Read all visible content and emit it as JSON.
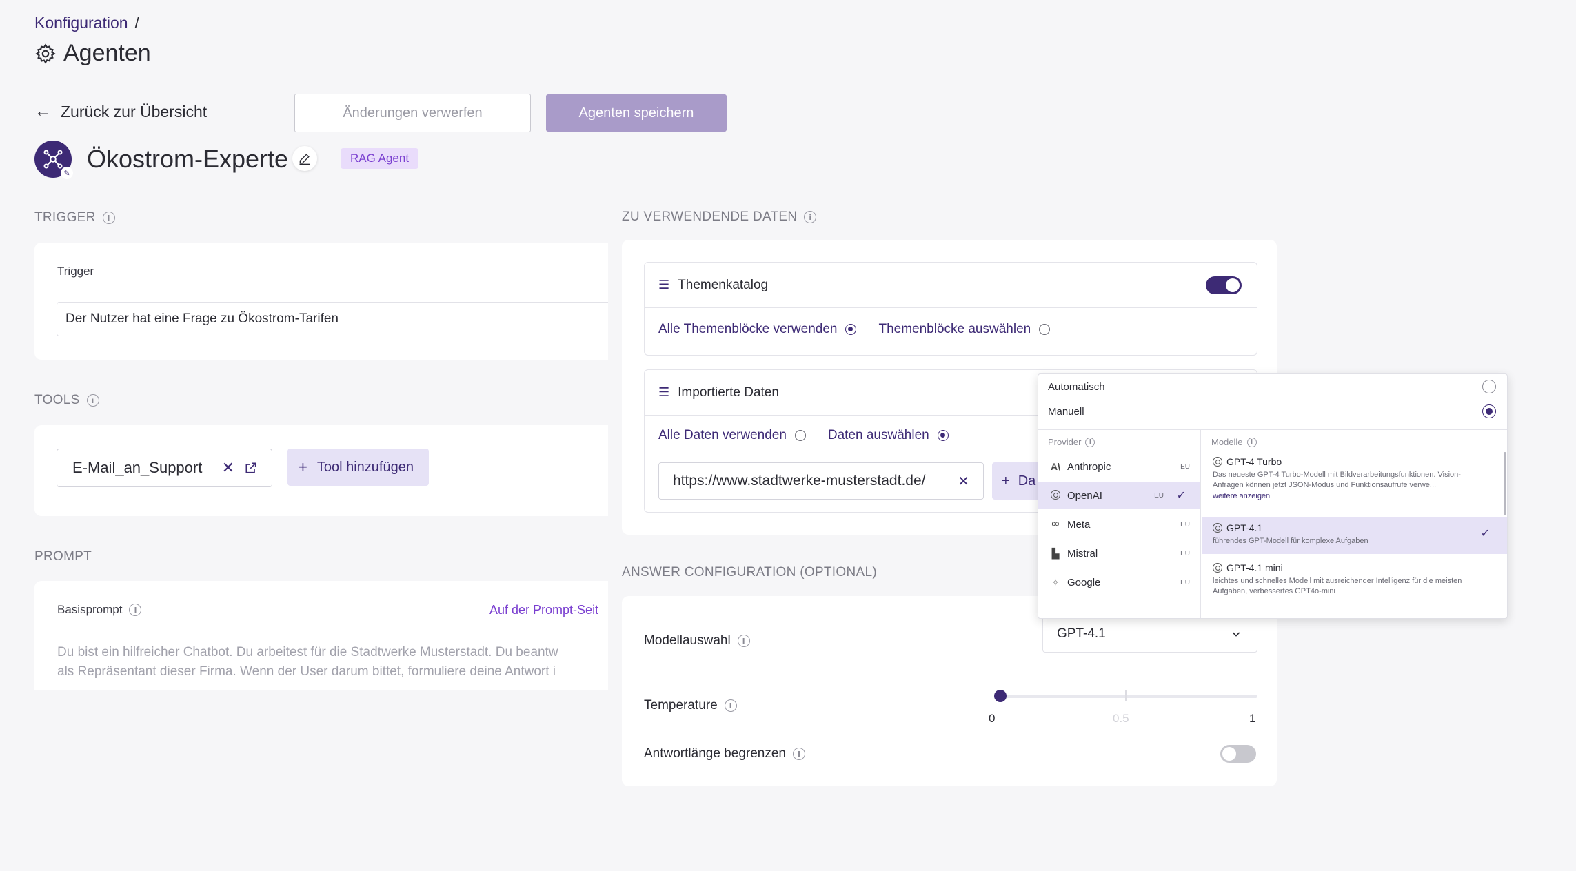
{
  "breadcrumb": {
    "item": "Konfiguration",
    "separator": "/"
  },
  "page": {
    "title": "Agenten"
  },
  "toolbar": {
    "back_label": "Zurück zur Übersicht",
    "discard_label": "Änderungen verwerfen",
    "save_label": "Agenten speichern"
  },
  "agent": {
    "name": "Ökostrom-Experte",
    "badge": "RAG Agent"
  },
  "trigger": {
    "section": "TRIGGER",
    "label": "Trigger",
    "value": "Der Nutzer hat eine Frage zu Ökostrom-Tarifen"
  },
  "tools": {
    "section": "TOOLS",
    "chip": "E-Mail_an_Support",
    "add_label": "Tool hinzufügen"
  },
  "prompt": {
    "section": "PROMPT",
    "label": "Basisprompt",
    "link": "Auf der Prompt-Seit",
    "text_line1": "Du bist ein hilfreicher Chatbot. Du arbeitest für die Stadtwerke Musterstadt. Du beantw",
    "text_line2": "als Repräsentant dieser Firma. Wenn der User darum bittet, formuliere deine Antwort i"
  },
  "data_section": {
    "section": "ZU VERWENDENDE DATEN",
    "catalog": {
      "title": "Themenkatalog",
      "enabled": true,
      "option_all": "Alle Themenblöcke verwenden",
      "option_select": "Themenblöcke auswählen"
    },
    "imported": {
      "title": "Importierte Daten",
      "option_all": "Alle Daten verwenden",
      "option_select": "Daten auswählen",
      "url": "https://www.stadtwerke-musterstadt.de/",
      "add_label": "Da"
    }
  },
  "answer_config": {
    "section": "ANSWER CONFIGURATION (OPTIONAL)",
    "model_label": "Modellauswahl",
    "model_value": "GPT-4.1",
    "temperature_label": "Temperature",
    "temperature_value": 0,
    "temp_min": "0",
    "temp_mid": "0.5",
    "temp_max": "1",
    "length_label": "Antwortlänge begrenzen",
    "length_enabled": false
  },
  "dropdown": {
    "mode_auto": "Automatisch",
    "mode_manual": "Manuell",
    "provider_header": "Provider",
    "models_header": "Modelle",
    "providers": [
      {
        "name": "Anthropic",
        "region": "EU",
        "icon": "anthropic-icon"
      },
      {
        "name": "OpenAI",
        "region": "EU",
        "icon": "openai-icon",
        "selected": true
      },
      {
        "name": "Meta",
        "region": "EU",
        "icon": "meta-icon"
      },
      {
        "name": "Mistral",
        "region": "EU",
        "icon": "mistral-icon"
      },
      {
        "name": "Google",
        "region": "EU",
        "icon": "google-icon"
      }
    ],
    "models": [
      {
        "name": "GPT-4 Turbo",
        "desc_line1": "Das neueste GPT-4 Turbo-Modell mit Bildverarbeitungsfunktionen. Vision-",
        "desc_line2": "Anfragen können jetzt JSON-Modus und Funktionsaufrufe verwe...",
        "more": "weitere anzeigen"
      },
      {
        "name": "GPT-4.1",
        "desc_line1": "führendes GPT-Modell für komplexe Aufgaben",
        "selected": true
      },
      {
        "name": "GPT-4.1 mini",
        "desc_line1": "leichtes und schnelles Modell mit ausreichender Intelligenz für die meisten",
        "desc_line2": "Aufgaben, verbessertes GPT4o-mini"
      }
    ]
  },
  "colors": {
    "accent": "#3d2a75",
    "accent_light": "#e6e2f6",
    "save_button": "#a99bc9",
    "badge_bg": "#e9dcfb",
    "badge_text": "#7a3fd0"
  }
}
